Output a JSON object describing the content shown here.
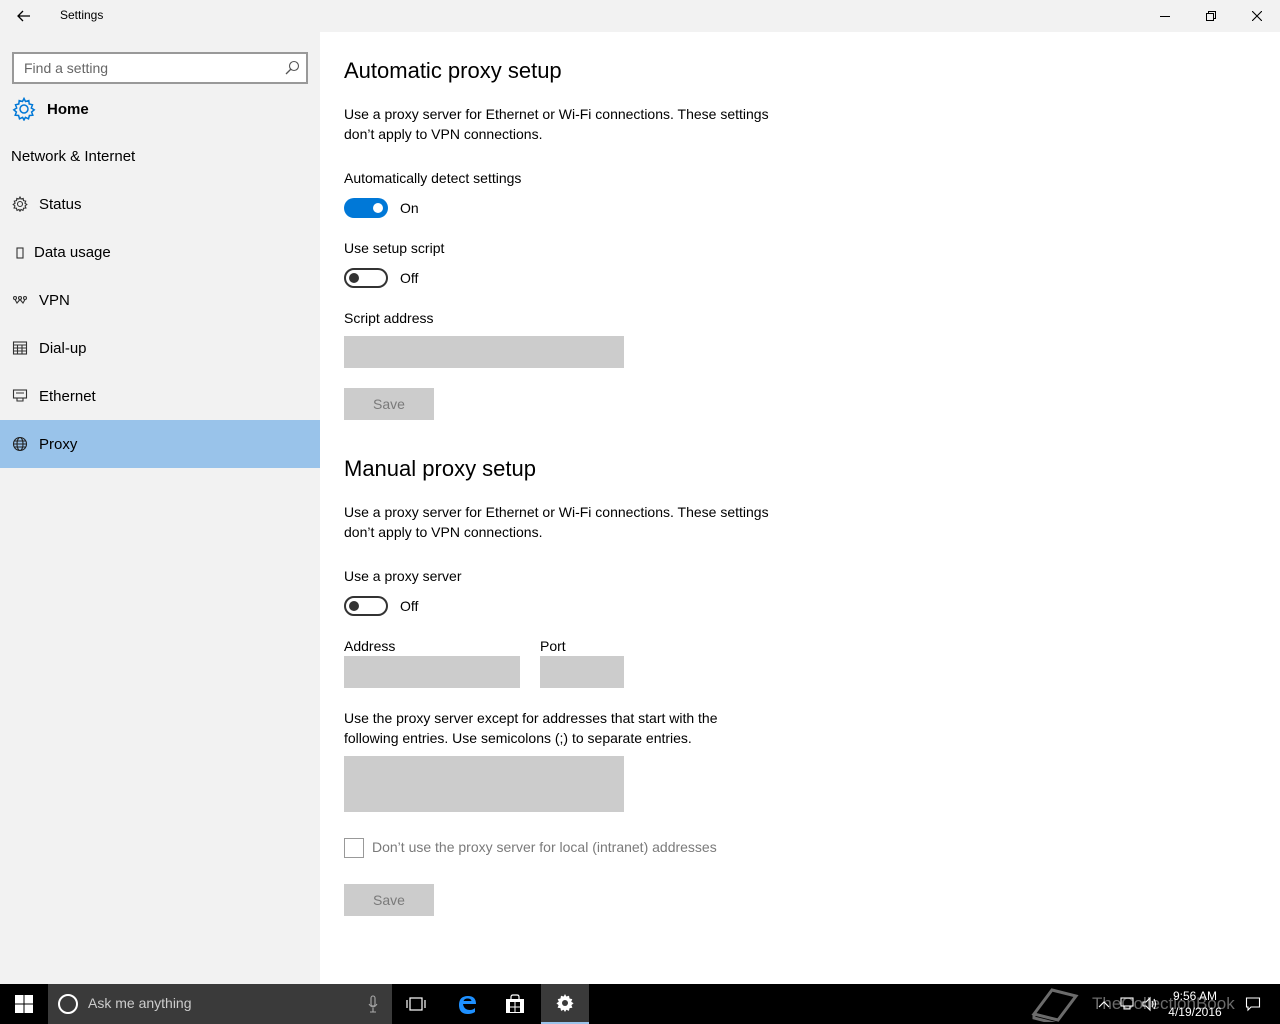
{
  "window": {
    "title": "Settings"
  },
  "sidebar": {
    "search_placeholder": "Find a setting",
    "home_label": "Home",
    "section_title": "Network & Internet",
    "items": [
      {
        "label": "Status",
        "icon": "gear-icon"
      },
      {
        "label": "Data usage",
        "icon": "data-usage-icon"
      },
      {
        "label": "VPN",
        "icon": "vpn-icon"
      },
      {
        "label": "Dial-up",
        "icon": "dial-up-icon"
      },
      {
        "label": "Ethernet",
        "icon": "ethernet-icon"
      },
      {
        "label": "Proxy",
        "icon": "globe-icon",
        "selected": true
      }
    ]
  },
  "auto": {
    "heading": "Automatic proxy setup",
    "desc_line1": "Use a proxy server for Ethernet or Wi-Fi connections. These settings",
    "desc_line2": "don’t apply to VPN connections.",
    "detect_label": "Automatically detect settings",
    "detect_state": "On",
    "script_label": "Use setup script",
    "script_state": "Off",
    "script_address_label": "Script address",
    "script_address_value": "",
    "save_label": "Save"
  },
  "manual": {
    "heading": "Manual proxy setup",
    "desc_line1": "Use a proxy server for Ethernet or Wi-Fi connections. These settings",
    "desc_line2": "don’t apply to VPN connections.",
    "use_proxy_label": "Use a proxy server",
    "use_proxy_state": "Off",
    "address_label": "Address",
    "address_value": "",
    "port_label": "Port",
    "port_value": "",
    "exceptions_line1": "Use the proxy server except for addresses that start with the",
    "exceptions_line2": "following entries. Use semicolons (;) to separate entries.",
    "exceptions_value": "",
    "local_checkbox_label": "Don’t use the proxy server for local (intranet) addresses",
    "local_checkbox_checked": false,
    "save_label": "Save"
  },
  "taskbar": {
    "cortana_placeholder": "Ask me anything",
    "time": "9:56 AM",
    "date": "4/19/2016",
    "watermark": "TheCollectionBook"
  },
  "colors": {
    "accent": "#0078d7",
    "selected_bg": "#99c3ea",
    "sidebar_bg": "#f2f2f2",
    "disabled_box": "#cccccc"
  }
}
